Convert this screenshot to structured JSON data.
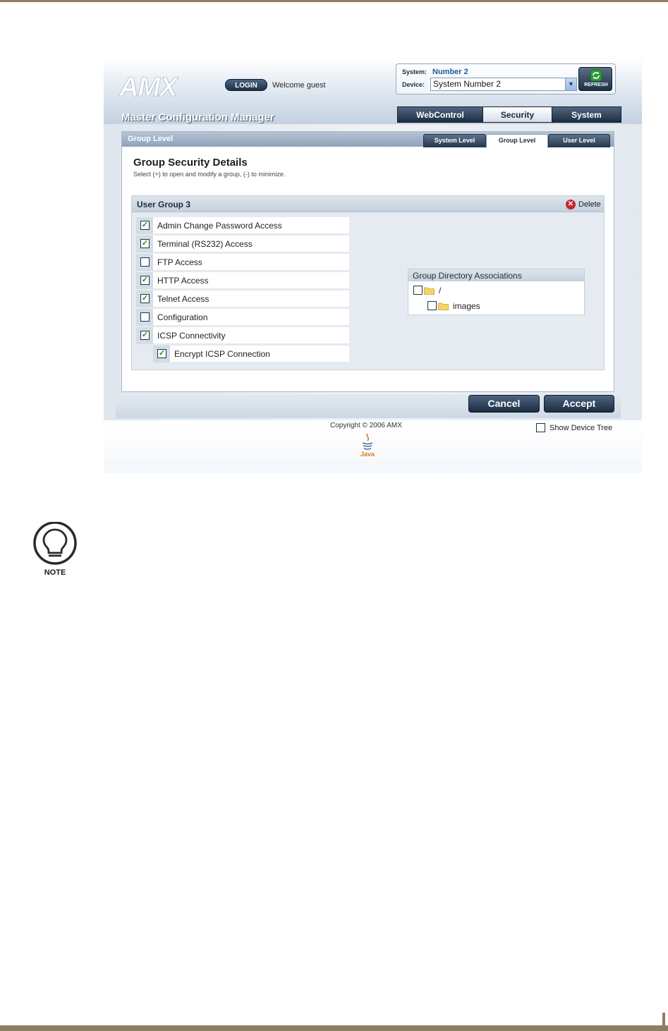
{
  "app": {
    "logo_text": "AMX",
    "login_label": "LOGIN",
    "welcome": "Welcome guest",
    "title": "Master Configuration Manager"
  },
  "system_box": {
    "system_label": "System:",
    "system_value": "Number 2",
    "device_label": "Device:",
    "device_value": "System Number 2",
    "refresh_label": "REFRESH"
  },
  "main_tabs": [
    {
      "label": "WebControl",
      "active": false
    },
    {
      "label": "Security",
      "active": true
    },
    {
      "label": "System",
      "active": false
    }
  ],
  "panel": {
    "header_title": "Group Level",
    "sub_tabs": [
      {
        "label": "System Level",
        "active": false
      },
      {
        "label": "Group Level",
        "active": true
      },
      {
        "label": "User Level",
        "active": false
      }
    ],
    "details_title": "Group Security Details",
    "details_hint": "Select (+) to open and modify a group, (-) to minimize."
  },
  "group": {
    "title": "User Group 3",
    "delete_label": "Delete",
    "permissions": [
      {
        "label": "Admin Change Password Access",
        "checked": true
      },
      {
        "label": "Terminal (RS232) Access",
        "checked": true
      },
      {
        "label": "FTP Access",
        "checked": false
      },
      {
        "label": "HTTP Access",
        "checked": true
      },
      {
        "label": "Telnet Access",
        "checked": true
      },
      {
        "label": "Configuration",
        "checked": false
      },
      {
        "label": "ICSP Connectivity",
        "checked": true
      },
      {
        "label": "Encrypt ICSP Connection",
        "checked": true
      }
    ],
    "directory": {
      "title": "Group Directory Associations",
      "entries": [
        {
          "label": "/",
          "checked": false
        },
        {
          "label": "images",
          "checked": false
        }
      ]
    }
  },
  "footer": {
    "cancel_label": "Cancel",
    "accept_label": "Accept",
    "copyright": "Copyright © 2006 AMX",
    "show_device_tree": "Show Device Tree",
    "java_label": "Java"
  },
  "note": {
    "label": "NOTE"
  },
  "colors": {
    "accent_blue": "#1e5aa0",
    "dark_button": "#1b2d42",
    "check_green": "#1f8a1f",
    "delete_red": "#c8252a",
    "page_rule": "#8b8060"
  }
}
